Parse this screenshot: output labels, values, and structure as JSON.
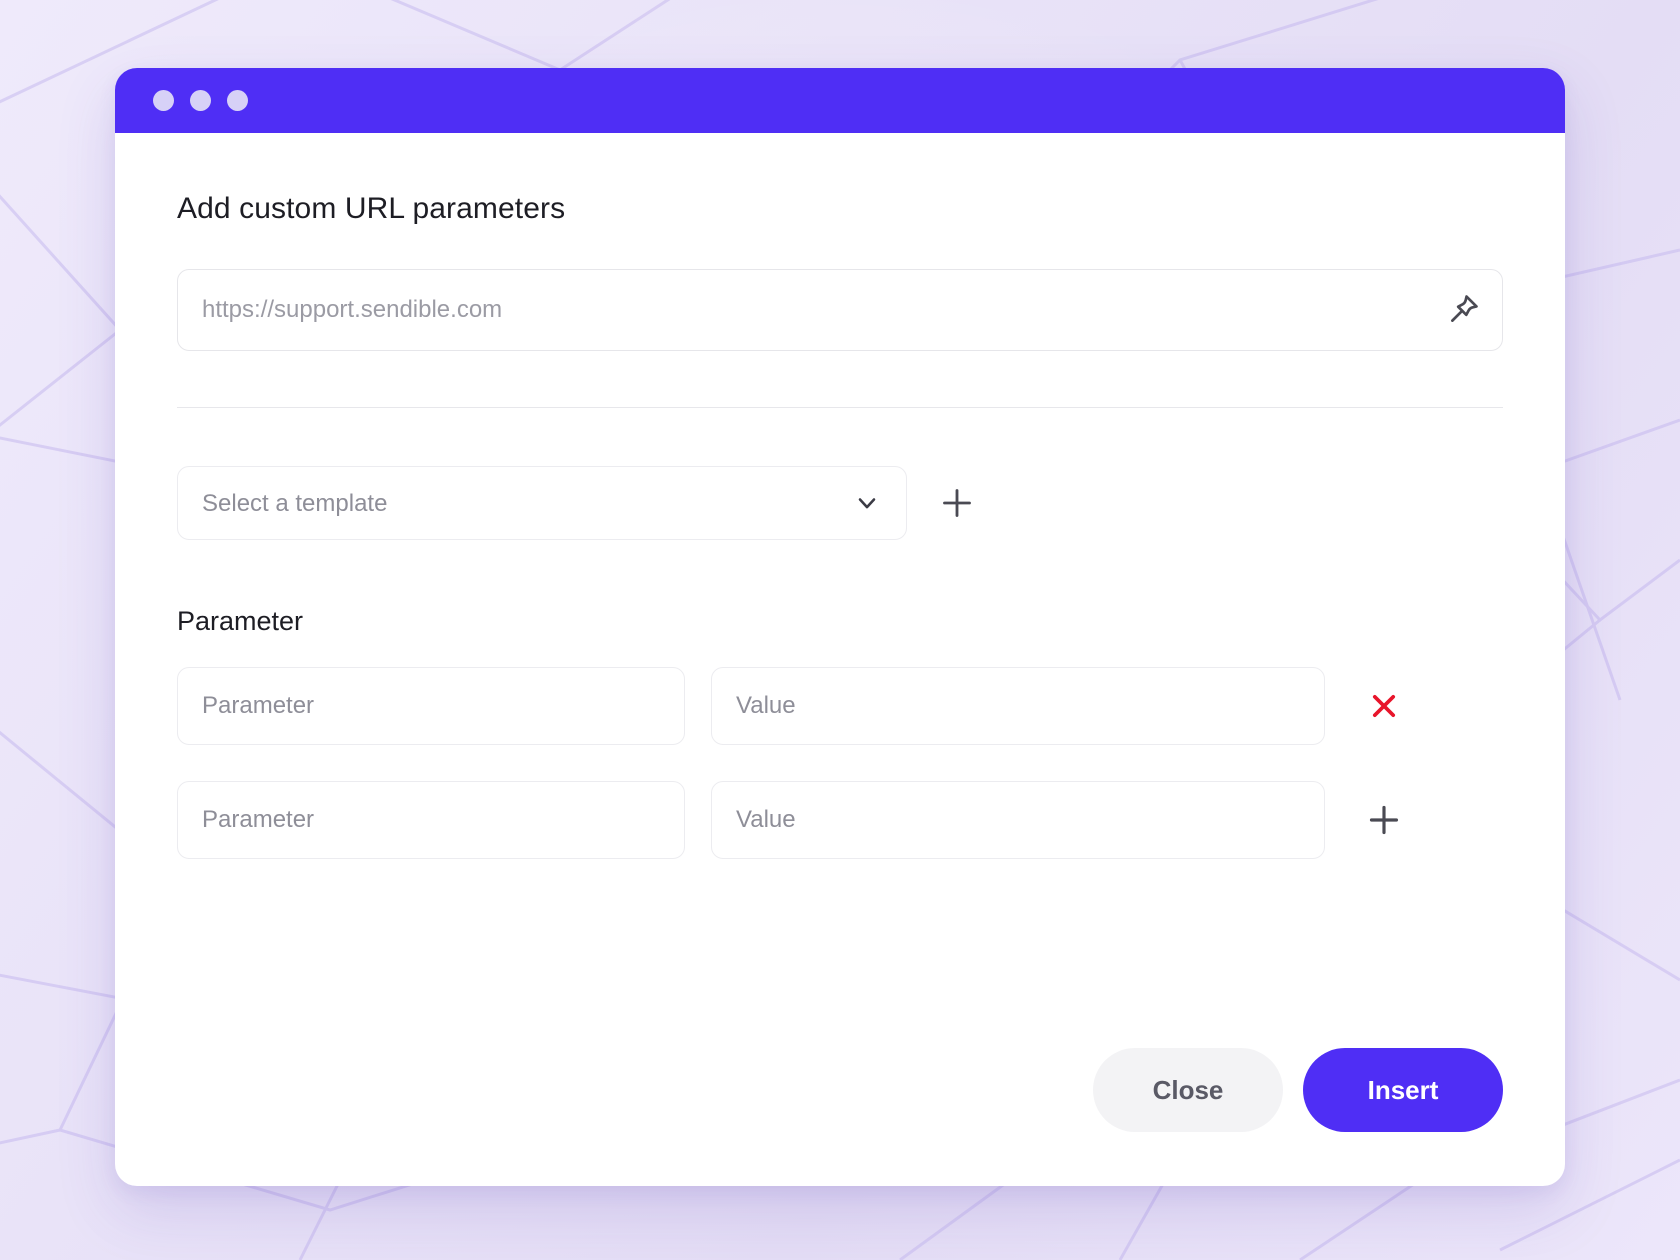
{
  "window": {
    "title_bar": {
      "dots": [
        "dot-one",
        "dot-two",
        "dot-three"
      ],
      "bar_color": "#4f2ef5",
      "dot_color": "#d7d1f7"
    }
  },
  "dialog": {
    "title": "Add custom URL parameters",
    "url_field": {
      "value": "",
      "placeholder": "https://support.sendible.com",
      "pin_icon": "pin-icon"
    },
    "template": {
      "placeholder": "Select a template",
      "selected": "Select a template",
      "options": [
        "Select a template"
      ],
      "chevron_icon": "chevron-down-icon",
      "add_icon": "plus-icon"
    },
    "parameters": {
      "section_label": "Parameter",
      "rows": [
        {
          "param_placeholder": "Parameter",
          "param_value": "",
          "value_placeholder": "Value",
          "value_value": "",
          "action_icon": "close-x-icon",
          "action_color": "#e8152b"
        },
        {
          "param_placeholder": "Parameter",
          "param_value": "",
          "value_placeholder": "Value",
          "value_value": "",
          "action_icon": "plus-icon",
          "action_color": "#4a4a53"
        }
      ]
    },
    "footer": {
      "close_label": "Close",
      "insert_label": "Insert"
    }
  },
  "theme": {
    "accent": "#4f2ef5",
    "danger": "#e8152b",
    "background_start": "#efeafb",
    "background_end": "#ece6fa",
    "card_background": "#ffffff",
    "border": "#ececf0",
    "placeholder_text": "#8e8e98"
  }
}
